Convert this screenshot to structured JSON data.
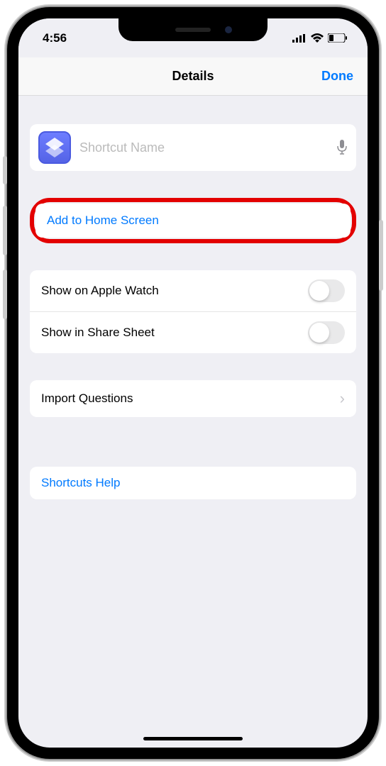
{
  "status": {
    "time": "4:56"
  },
  "nav": {
    "title": "Details",
    "done": "Done"
  },
  "shortcut": {
    "placeholder": "Shortcut Name"
  },
  "actions": {
    "addHome": "Add to Home Screen"
  },
  "toggles": {
    "watch": "Show on Apple Watch",
    "share": "Show in Share Sheet"
  },
  "importQ": "Import Questions",
  "help": "Shortcuts Help"
}
